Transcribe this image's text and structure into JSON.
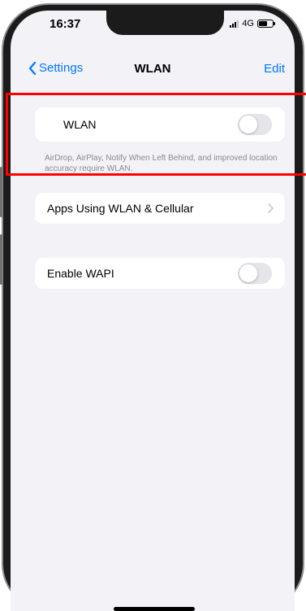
{
  "status_bar": {
    "time": "16:37",
    "network": "4G"
  },
  "nav": {
    "back_label": "Settings",
    "title": "WLAN",
    "edit_label": "Edit"
  },
  "wlan_section": {
    "label": "WLAN",
    "toggle_on": false,
    "footer": "AirDrop, AirPlay, Notify When Left Behind, and improved location accuracy require WLAN."
  },
  "apps_row": {
    "label": "Apps Using WLAN & Cellular"
  },
  "wapi_row": {
    "label": "Enable WAPI",
    "toggle_on": false
  },
  "colors": {
    "accent": "#007aff",
    "background": "#f2f2f7",
    "toggle_off": "#e5e5ea",
    "highlight": "#ff0000"
  }
}
